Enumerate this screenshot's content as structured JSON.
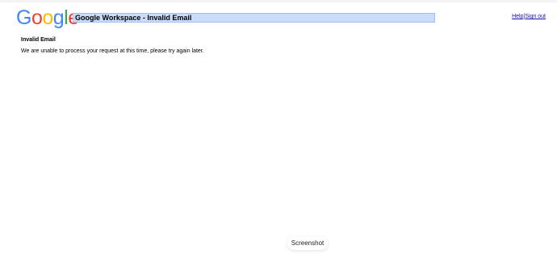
{
  "logo": {
    "text": "Google",
    "letters": [
      {
        "char": "G",
        "color": "#4285F4"
      },
      {
        "char": "o",
        "color": "#EA4335"
      },
      {
        "char": "o",
        "color": "#FBBC05"
      },
      {
        "char": "g",
        "color": "#4285F4"
      },
      {
        "char": "l",
        "color": "#34A853"
      },
      {
        "char": "e",
        "color": "#EA4335"
      }
    ]
  },
  "header": {
    "title": "Google Workspace - Invalid Email",
    "title_highlight_color": "#c9dcfb",
    "links": {
      "help": "Help",
      "separator": "|",
      "sign_out": "Sign out"
    },
    "link_color": "#1a0dab"
  },
  "main": {
    "heading": "Invalid Email",
    "message": "We are unable to process your request at this time, please try again later."
  },
  "overlay": {
    "screenshot_label": "Screenshot"
  }
}
